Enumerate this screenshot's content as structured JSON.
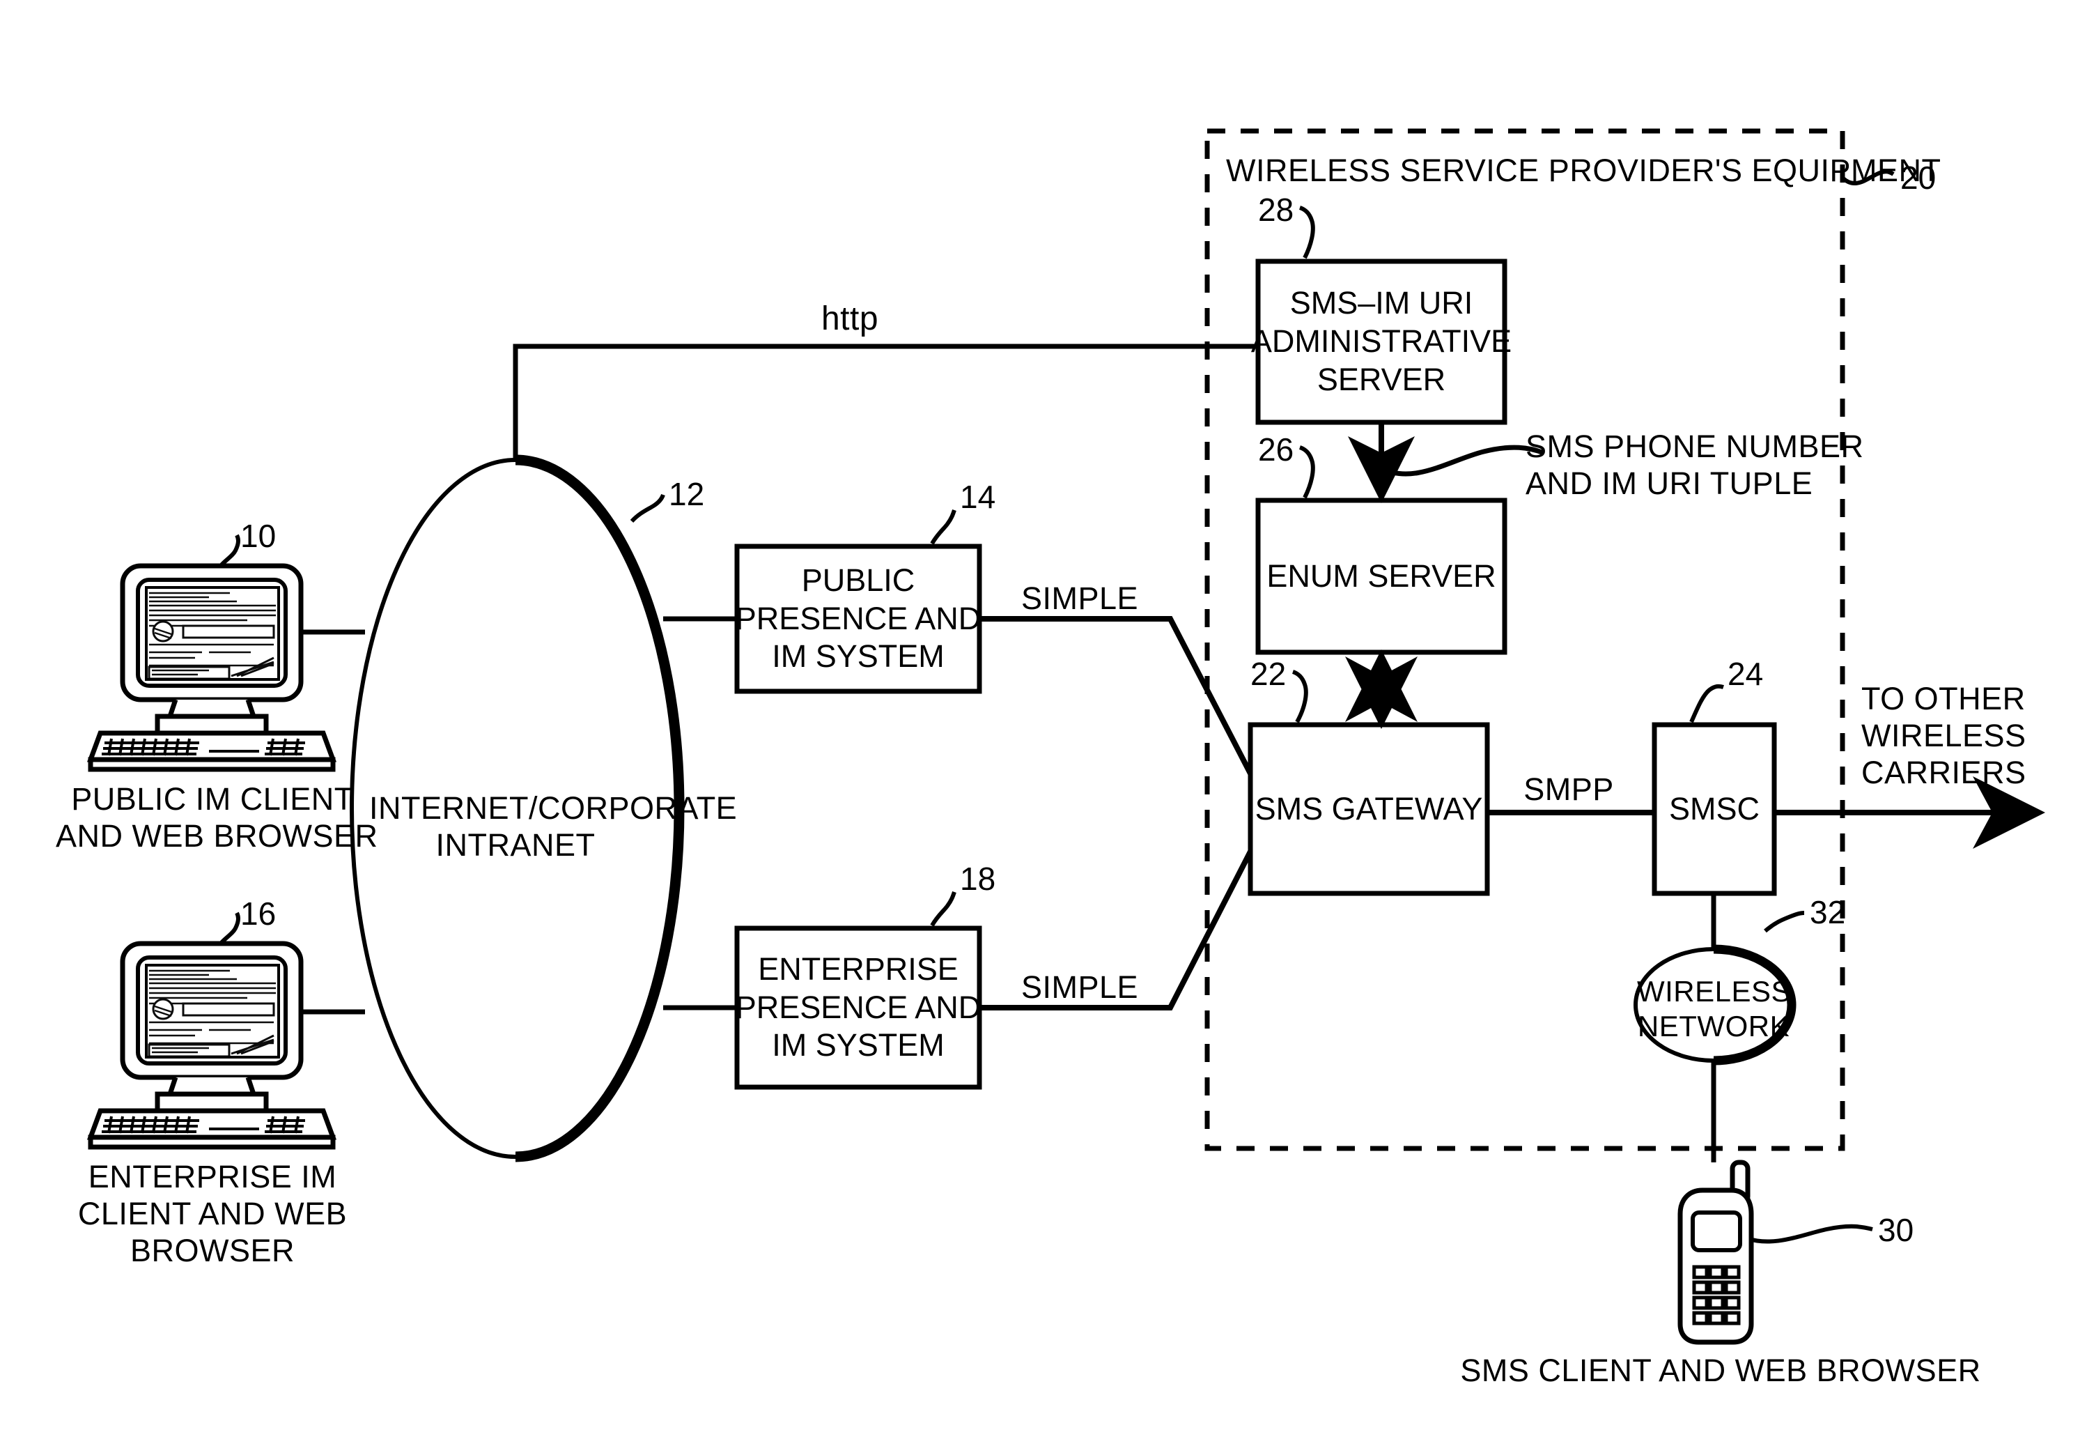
{
  "figure": {
    "type": "patent-block-diagram",
    "stroke_color": "#000000",
    "background_color": "#ffffff"
  },
  "boundary": {
    "name": "wireless-service-provider-boundary",
    "style": "dashed",
    "title": "WIRELESS SERVICE PROVIDER'S EQUIPMENT",
    "ref": "20"
  },
  "nodes": {
    "public_client": {
      "ref": "10",
      "label": "PUBLIC IM CLIENT\nAND WEB BROWSER",
      "icon": "desktop-computer-icon"
    },
    "enterprise_client": {
      "ref": "16",
      "label": "ENTERPRISE IM\nCLIENT AND WEB\nBROWSER",
      "icon": "desktop-computer-icon"
    },
    "network_cloud": {
      "ref": "12",
      "label": "INTERNET/CORPORATE\nINTRANET",
      "shape": "ellipse"
    },
    "public_presence": {
      "ref": "14",
      "label": "PUBLIC\nPRESENCE AND\nIM SYSTEM",
      "shape": "rect"
    },
    "enterprise_presence": {
      "ref": "18",
      "label": "ENTERPRISE\nPRESENCE AND\nIM SYSTEM",
      "shape": "rect"
    },
    "admin_server": {
      "ref": "28",
      "label": "SMS–IM URI\nADMINISTRATIVE\nSERVER",
      "shape": "rect"
    },
    "enum_server": {
      "ref": "26",
      "label": "ENUM SERVER",
      "shape": "rect"
    },
    "sms_gateway": {
      "ref": "22",
      "label": "SMS GATEWAY",
      "shape": "rect"
    },
    "smsc": {
      "ref": "24",
      "label": "SMSC",
      "shape": "rect"
    },
    "wireless_network": {
      "ref": "32",
      "label": "WIRELESS\nNETWORK",
      "shape": "ellipse"
    },
    "sms_client": {
      "ref": "30",
      "label": "SMS CLIENT AND WEB BROWSER",
      "icon": "mobile-phone-icon"
    }
  },
  "edge_labels": {
    "http": "http",
    "simple_public": "SIMPLE",
    "simple_enterprise": "SIMPLE",
    "smpp": "SMPP",
    "tuple_annotation": "SMS PHONE NUMBER\nAND IM URI TUPLE",
    "to_other_carriers": "TO OTHER\nWIRELESS\nCARRIERS"
  }
}
